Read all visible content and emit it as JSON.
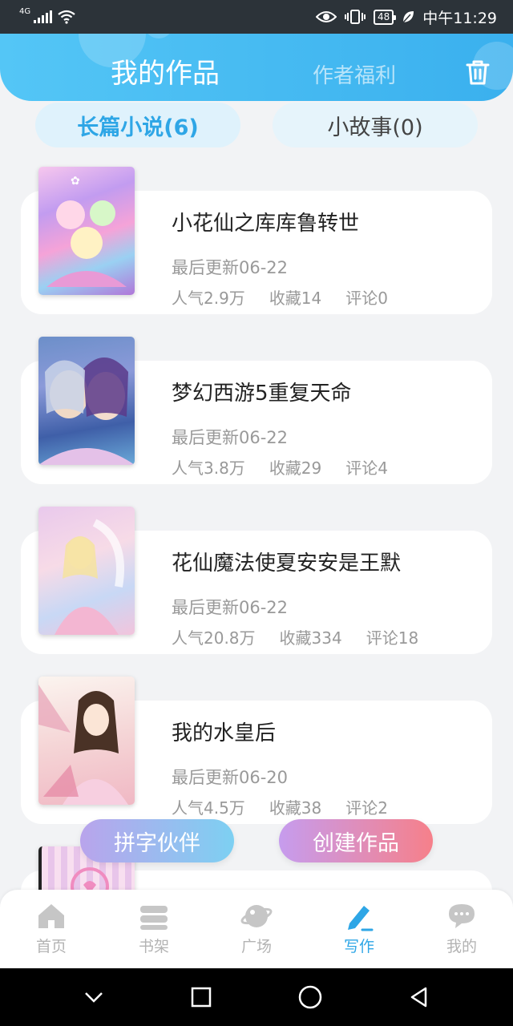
{
  "status_bar": {
    "network": "4G",
    "battery": "48",
    "time": "中午11:29"
  },
  "header": {
    "active_tab": "我的作品",
    "other_tab": "作者福利"
  },
  "subtabs": {
    "novel": "长篇小说(6)",
    "story": "小故事(0)"
  },
  "works": [
    {
      "title": "小花仙之库库鲁转世",
      "updated": "最后更新06-22",
      "popularity": "人气2.9万",
      "favorites": "收藏14",
      "comments": "评论0"
    },
    {
      "title": "梦幻西游5重复天命",
      "updated": "最后更新06-22",
      "popularity": "人气3.8万",
      "favorites": "收藏29",
      "comments": "评论4"
    },
    {
      "title": "花仙魔法使夏安安是王默",
      "updated": "最后更新06-22",
      "popularity": "人气20.8万",
      "favorites": "收藏334",
      "comments": "评论18"
    },
    {
      "title": "我的水皇后",
      "updated": "最后更新06-20",
      "popularity": "人气4.5万",
      "favorites": "收藏38",
      "comments": "评论2"
    }
  ],
  "floating": {
    "partner": "拼字伙伴",
    "create": "创建作品"
  },
  "bottom_nav": [
    {
      "label": "首页",
      "icon": "home-icon"
    },
    {
      "label": "书架",
      "icon": "bookshelf-icon"
    },
    {
      "label": "广场",
      "icon": "planet-icon"
    },
    {
      "label": "写作",
      "icon": "pen-icon"
    },
    {
      "label": "我的",
      "icon": "chat-bubble-icon"
    }
  ],
  "colors": {
    "accent": "#2ea6e6",
    "header_start": "#54c6f6",
    "header_end": "#3ab0ee",
    "inactive": "#b3b3b3"
  }
}
